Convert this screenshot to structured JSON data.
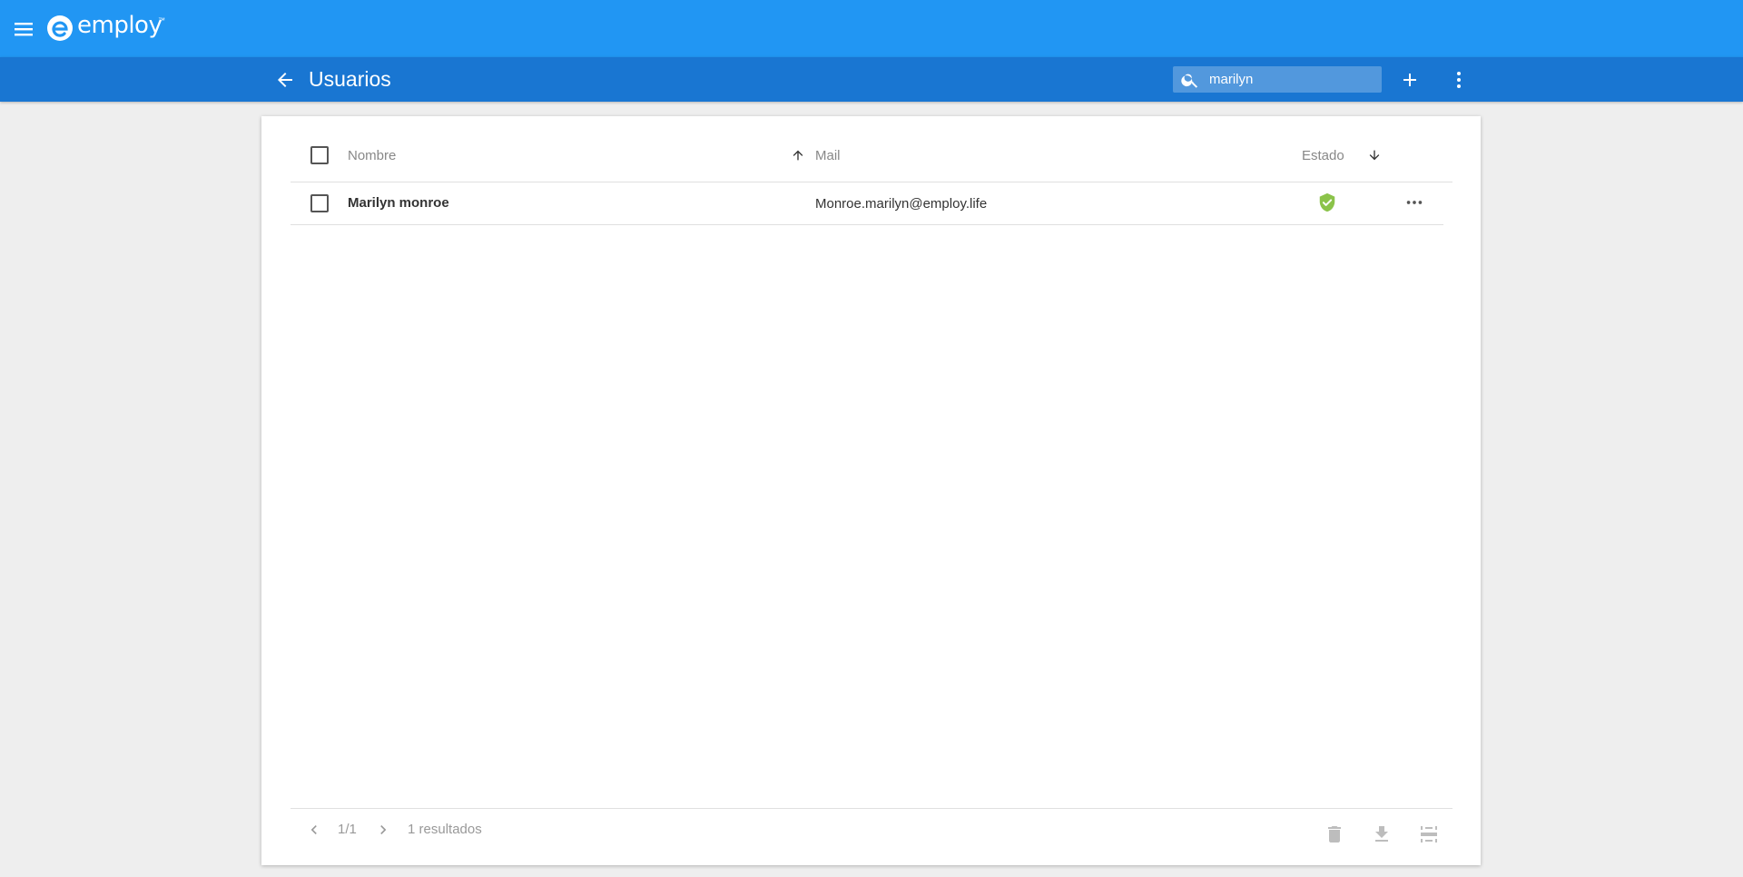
{
  "brand": {
    "name": "employ",
    "trademark": "™"
  },
  "header": {
    "title": "Usuarios"
  },
  "search": {
    "value": "marilyn",
    "placeholder": ""
  },
  "table": {
    "columns": {
      "name": "Nombre",
      "mail": "Mail",
      "status": "Estado"
    },
    "rows": [
      {
        "name": "Marilyn monroe",
        "mail": "Monroe.marilyn@employ.life",
        "status_icon": "verified-shield-icon"
      }
    ]
  },
  "pagination": {
    "page": "1/1",
    "results": "1 resultados"
  },
  "colors": {
    "primary": "#2196f3",
    "primary_dark": "#1976d2",
    "status_ok": "#8bc34a"
  },
  "icons": [
    "menu-icon",
    "employ-logo-icon",
    "back-arrow-icon",
    "search-icon",
    "add-icon",
    "more-vertical-icon",
    "sort-up-icon",
    "sort-down-icon",
    "verified-shield-icon",
    "more-horizontal-icon",
    "chevron-left-icon",
    "chevron-right-icon",
    "delete-icon",
    "download-icon",
    "columns-icon"
  ]
}
